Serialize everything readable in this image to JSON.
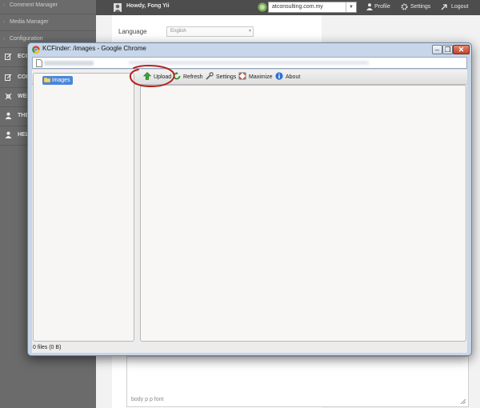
{
  "background": {
    "sidebar_items": [
      "Comment Manager",
      "Media Manager",
      "Configuration"
    ],
    "sidebar_big_items": [
      "ECO",
      "CON",
      "WEB",
      "THE",
      "HEL"
    ],
    "topbar": {
      "user": "Howdy, Fong Yii",
      "site": "atconsulting.com.my",
      "profile": "Profile",
      "settings": "Settings",
      "logout": "Logout"
    },
    "language_label": "Language",
    "language_value": "English",
    "editor_status": "body  p  p  font"
  },
  "popup": {
    "title": "KCFinder: /images - Google Chrome",
    "toolbar": {
      "upload": "Upload",
      "refresh": "Refresh",
      "settings": "Settings",
      "maximize": "Maximize",
      "about": "About"
    },
    "tree_folder": "images",
    "status": "0 files (0 B)"
  },
  "colors": {
    "annotation": "#b3231f",
    "folder_selected": "#4a86d8"
  }
}
